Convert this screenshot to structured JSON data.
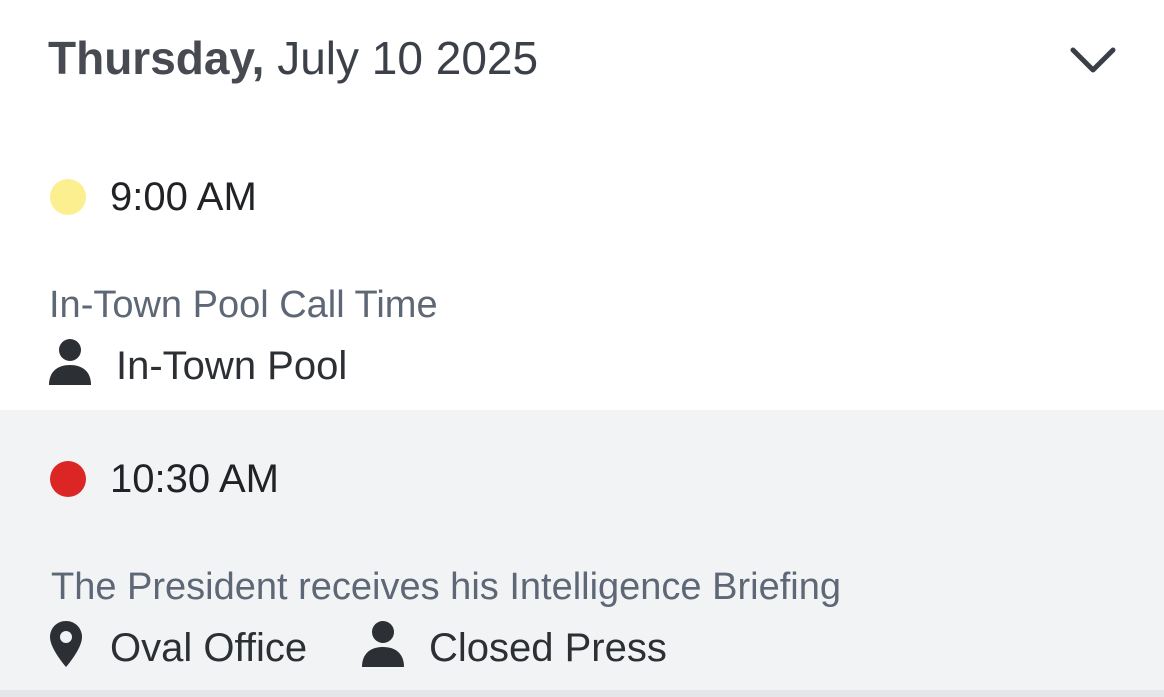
{
  "day": {
    "weekday": "Thursday,",
    "date": "July 10 2025",
    "toggle_icon": "chevron-down-icon"
  },
  "events": [
    {
      "time": "9:00 AM",
      "status_color": "#fbef8f",
      "title": "In-Town Pool Call Time",
      "coverage_icon": "person-icon",
      "coverage": "In-Town Pool"
    },
    {
      "time": "10:30 AM",
      "status_color": "#dc2626",
      "title": "The President receives his Intelligence Briefing",
      "location_icon": "map-pin-icon",
      "location": "Oval Office",
      "coverage_icon": "person-icon",
      "coverage": "Closed Press"
    }
  ]
}
